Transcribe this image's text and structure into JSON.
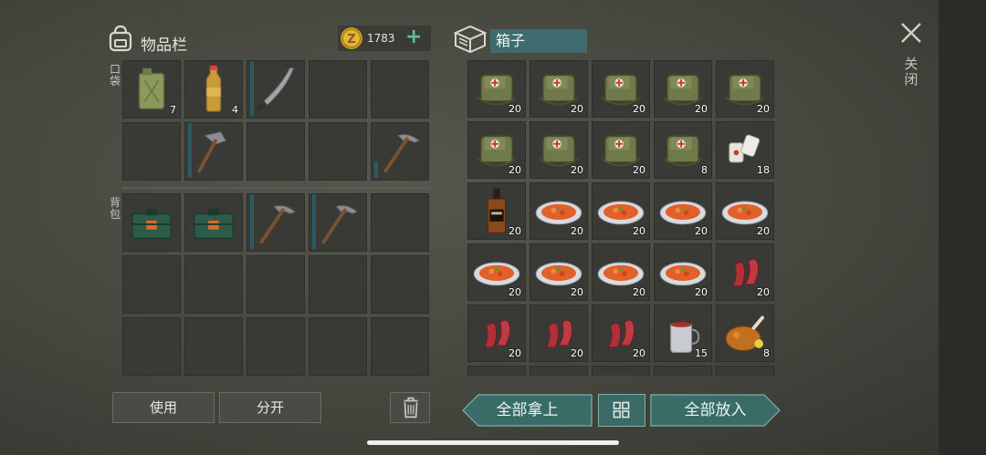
{
  "inventory": {
    "title": "物品栏",
    "coins": "1783",
    "coin_plus": "+",
    "pocket_label": "口袋",
    "backpack_label": "背包",
    "pocket_slots": [
      {
        "item": "jerrycan-icon",
        "count": "7"
      },
      {
        "item": "water-bottle-icon",
        "count": "4"
      },
      {
        "item": "machete-icon",
        "count": "",
        "bar": true
      },
      {
        "item": "",
        "count": ""
      },
      {
        "item": "",
        "count": ""
      },
      {
        "item": "",
        "count": ""
      },
      {
        "item": "hammer-icon",
        "count": "",
        "bar": true
      },
      {
        "item": "",
        "count": ""
      },
      {
        "item": "",
        "count": ""
      },
      {
        "item": "pickaxe-icon",
        "count": "",
        "bar_short": true
      }
    ],
    "backpack_slots": [
      {
        "item": "military-case-icon",
        "count": ""
      },
      {
        "item": "military-case-icon",
        "count": ""
      },
      {
        "item": "pickaxe-icon",
        "count": "",
        "bar": true
      },
      {
        "item": "pickaxe-icon",
        "count": "",
        "bar": true
      },
      {
        "item": "",
        "count": ""
      },
      {
        "item": "",
        "count": ""
      },
      {
        "item": "",
        "count": ""
      },
      {
        "item": "",
        "count": ""
      },
      {
        "item": "",
        "count": ""
      },
      {
        "item": "",
        "count": ""
      },
      {
        "item": "",
        "count": ""
      },
      {
        "item": "",
        "count": ""
      },
      {
        "item": "",
        "count": ""
      },
      {
        "item": "",
        "count": ""
      },
      {
        "item": "",
        "count": ""
      }
    ]
  },
  "box": {
    "title": "箱子",
    "slots": [
      {
        "item": "medkit-bag-icon",
        "count": "20"
      },
      {
        "item": "medkit-bag-icon",
        "count": "20"
      },
      {
        "item": "medkit-bag-icon",
        "count": "20"
      },
      {
        "item": "medkit-bag-icon",
        "count": "20"
      },
      {
        "item": "medkit-bag-icon",
        "count": "20"
      },
      {
        "item": "medkit-bag-icon",
        "count": "20"
      },
      {
        "item": "medkit-bag-icon",
        "count": "20"
      },
      {
        "item": "medkit-bag-icon",
        "count": "20"
      },
      {
        "item": "medkit-bag-icon",
        "count": "8"
      },
      {
        "item": "bandage-icon",
        "count": "18"
      },
      {
        "item": "whiskey-bottle-icon",
        "count": "20"
      },
      {
        "item": "food-plate-icon",
        "count": "20"
      },
      {
        "item": "food-plate-icon",
        "count": "20"
      },
      {
        "item": "food-plate-icon",
        "count": "20"
      },
      {
        "item": "food-plate-icon",
        "count": "20"
      },
      {
        "item": "food-plate-icon",
        "count": "20"
      },
      {
        "item": "food-plate-icon",
        "count": "20"
      },
      {
        "item": "food-plate-icon",
        "count": "20"
      },
      {
        "item": "food-plate-icon",
        "count": "20"
      },
      {
        "item": "bacon-icon",
        "count": "20"
      },
      {
        "item": "bacon-icon",
        "count": "20"
      },
      {
        "item": "bacon-icon",
        "count": "20"
      },
      {
        "item": "bacon-icon",
        "count": "20"
      },
      {
        "item": "tea-mug-icon",
        "count": "15"
      },
      {
        "item": "roast-chicken-icon",
        "count": "8"
      }
    ]
  },
  "close_label": "关闭",
  "buttons": {
    "use": "使用",
    "split": "分开",
    "take_all": "全部拿上",
    "put_all": "全部放入"
  },
  "colors": {
    "accent_teal": "#3d6b6e",
    "coin_gold": "#d8a92a",
    "plus_green": "#5fbf9c"
  }
}
